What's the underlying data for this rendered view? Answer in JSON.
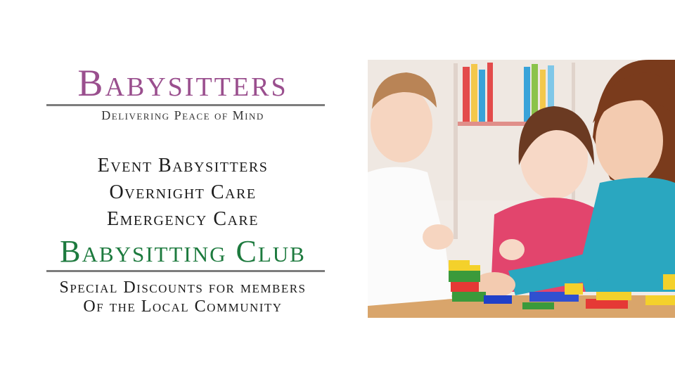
{
  "brand": {
    "title": "Babysitters",
    "tagline": "Delivering Peace of Mind"
  },
  "services": [
    "Event Babysitters",
    "Overnight Care",
    "Emergency Care"
  ],
  "club": {
    "title": "Babysitting Club",
    "discount_lines": [
      "Special Discounts for members",
      "Of the Local Community"
    ]
  },
  "colors": {
    "title": "#9a4f8e",
    "club": "#1d7a3e",
    "text": "#1b1b1b",
    "rule": "#7d7d7d"
  }
}
